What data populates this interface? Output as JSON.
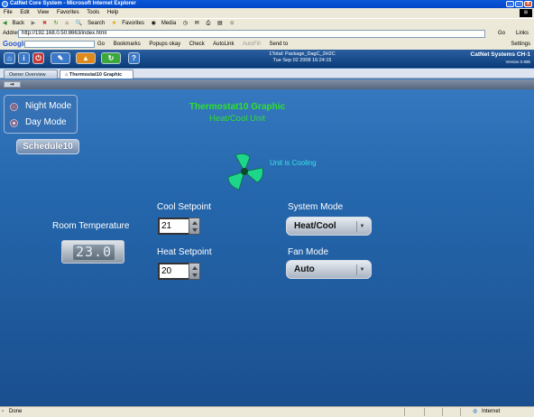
{
  "window": {
    "title": "CatNet Core System - Microsoft Internet Explorer",
    "controls": [
      "_",
      "□",
      "x"
    ]
  },
  "menu": [
    "File",
    "Edit",
    "View",
    "Favorites",
    "Tools",
    "Help"
  ],
  "toolbar": {
    "back": "Back",
    "search": "Search",
    "favorites": "Favorites",
    "media": "Media"
  },
  "address": {
    "label": "Address",
    "url": "http://192.168.0.50:8663/index.html",
    "go": "Go",
    "links": "Links"
  },
  "google_bar": {
    "logo": "Google",
    "go": "Go",
    "items": [
      "Bookmarks",
      "Popups okay",
      "Check",
      "AutoLink",
      "AutoFill",
      "Send to"
    ],
    "settings": "Settings"
  },
  "app": {
    "header": {
      "line1": "1Total: Package_DagC_2H2C",
      "line2": "Tue Sep 02 2008 16:24:15",
      "brand": "CatNet Systems CH-1",
      "version": "Version 0.99b"
    },
    "tabs": [
      "Owner Overview",
      "Thermostat10 Graphic"
    ],
    "modes": {
      "night": "Night Mode",
      "day": "Day Mode",
      "selected": "Day Mode"
    },
    "schedule_button": "Schedule10",
    "title": "Thermostat10 Graphic",
    "subtitle": "Heat/Cool Unit",
    "status": "Unit is Cooling",
    "room_temp_label": "Room Temperature",
    "room_temp": "23.0",
    "cool_setpoint_label": "Cool Setpoint",
    "cool_setpoint": "21",
    "heat_setpoint_label": "Heat Setpoint",
    "heat_setpoint": "20",
    "system_mode_label": "System Mode",
    "system_mode": "Heat/Cool",
    "fan_mode_label": "Fan Mode",
    "fan_mode": "Auto",
    "colors": {
      "title": "#2fe02a",
      "status": "#32e4e8"
    }
  },
  "statusbar": {
    "left": "Done",
    "right": "Internet"
  }
}
